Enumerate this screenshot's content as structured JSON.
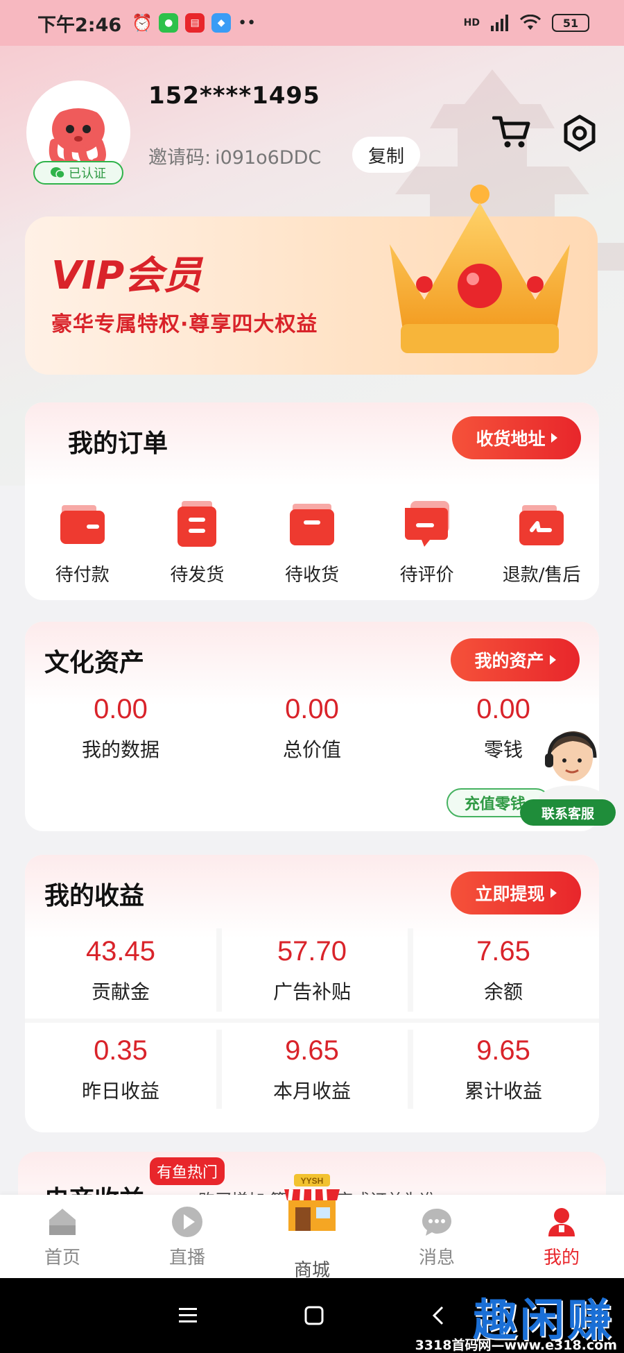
{
  "status_bar": {
    "time": "下午2:46",
    "network": "HD",
    "battery": "51"
  },
  "profile": {
    "phone": "152****1495",
    "verified": "已认证",
    "invite_label": "邀请码:",
    "invite_code": "i091o6DDC",
    "copy_label": "复制"
  },
  "vip": {
    "title": "VIP会员",
    "subtitle": "豪华专属特权·尊享四大权益"
  },
  "orders": {
    "title": "我的订单",
    "address_button": "收货地址",
    "items": [
      {
        "label": "待付款",
        "icon": "wallet-icon"
      },
      {
        "label": "待发货",
        "icon": "package-icon"
      },
      {
        "label": "待收货",
        "icon": "inbox-icon"
      },
      {
        "label": "待评价",
        "icon": "review-icon"
      },
      {
        "label": "退款/售后",
        "icon": "refund-icon"
      }
    ]
  },
  "assets": {
    "title": "文化资产",
    "my_assets_button": "我的资产",
    "items": [
      {
        "value": "0.00",
        "label": "我的数据"
      },
      {
        "value": "0.00",
        "label": "总价值"
      },
      {
        "value": "0.00",
        "label": "零钱"
      }
    ],
    "recharge_button": "充值零钱",
    "customer_service": "联系客服"
  },
  "earnings": {
    "title": "我的收益",
    "withdraw_button": "立即提现",
    "rows": [
      [
        {
          "value": "43.45",
          "label": "贡献金"
        },
        {
          "value": "57.70",
          "label": "广告补贴"
        },
        {
          "value": "7.65",
          "label": "余额"
        }
      ],
      [
        {
          "value": "0.35",
          "label": "昨日收益"
        },
        {
          "value": "9.65",
          "label": "本月收益"
        },
        {
          "value": "9.65",
          "label": "累计收益"
        }
      ]
    ]
  },
  "ecommerce": {
    "title": "电商收益",
    "hot_tag": "有鱼热门",
    "desc": "购买增加       算以成功完成订单为准~"
  },
  "bottom_nav": {
    "items": [
      {
        "label": "首页",
        "icon": "home-icon"
      },
      {
        "label": "直播",
        "icon": "play-icon"
      },
      {
        "label": "商城",
        "icon": "shop-icon",
        "badge": "YYSH"
      },
      {
        "label": "消息",
        "icon": "message-icon"
      },
      {
        "label": "我的",
        "icon": "profile-icon"
      }
    ],
    "active_index": 4
  },
  "watermark": {
    "text": "趣闲赚",
    "url": "3318首码网—www.e318.com"
  },
  "colors": {
    "accent_red": "#e8262b",
    "status_pink": "#f7b8c0",
    "verified_green": "#2fb34a"
  }
}
